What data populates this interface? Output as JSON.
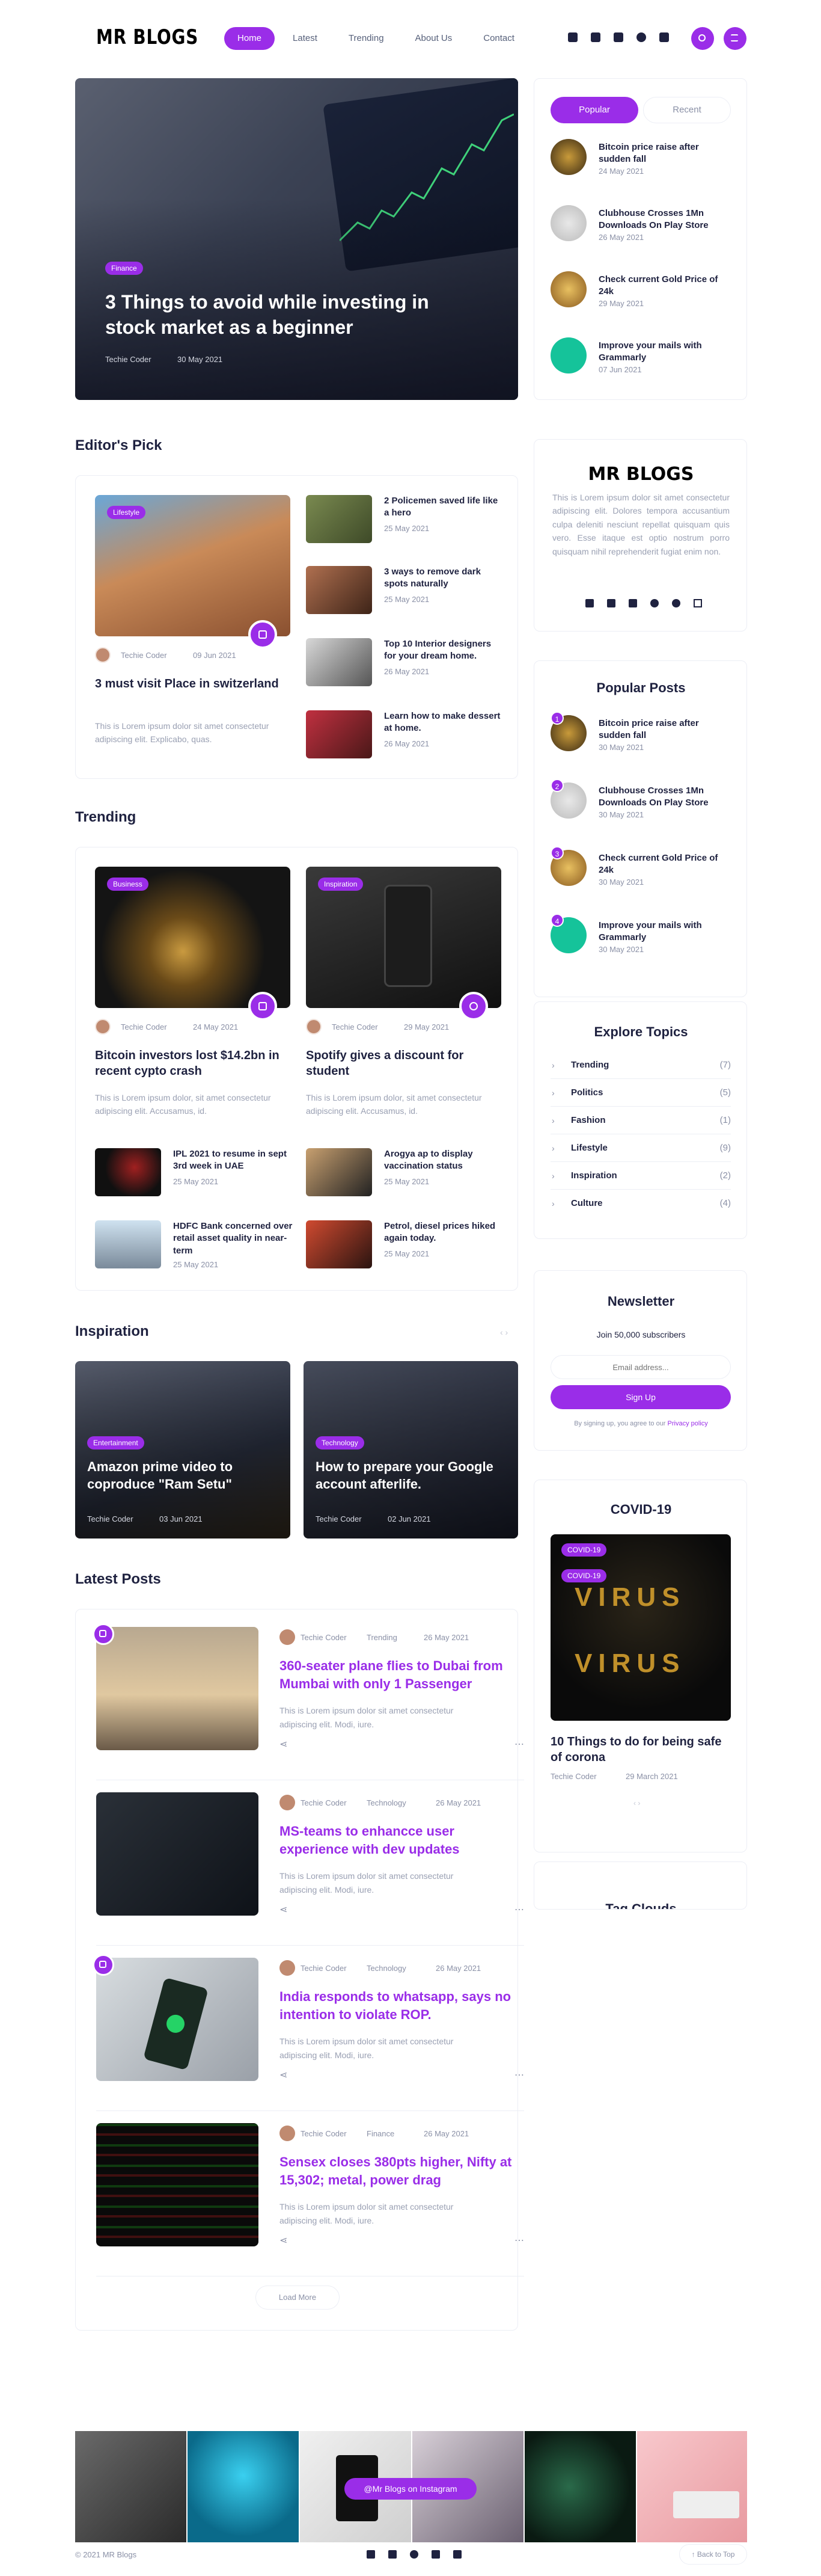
{
  "header": {
    "logo": "MR BLOGS",
    "nav": [
      "Home",
      "Latest",
      "Trending",
      "About Us",
      "Contact"
    ]
  },
  "hero": {
    "tag": "Finance",
    "title": "3 Things to avoid while investing in stock market as a beginner",
    "author": "Techie Coder",
    "date": "30 May 2021"
  },
  "sidebar_tabs": {
    "popular": "Popular",
    "recent": "Recent",
    "items": [
      {
        "title": "Bitcoin price raise after sudden fall",
        "date": "24 May 2021"
      },
      {
        "title": "Clubhouse Crosses 1Mn Downloads On Play Store",
        "date": "26 May 2021"
      },
      {
        "title": "Check current Gold Price of 24k",
        "date": "29 May 2021"
      },
      {
        "title": "Improve your mails with Grammarly",
        "date": "07 Jun 2021"
      }
    ]
  },
  "editors": {
    "heading": "Editor's Pick",
    "main": {
      "tag": "Lifestyle",
      "author": "Techie Coder",
      "date": "09 Jun 2021",
      "title": "3 must visit Place in switzerland",
      "excerpt": "This is Lorem ipsum dolor sit amet consectetur adipiscing elit. Explicabo, quas."
    },
    "list": [
      {
        "title": "2 Policemen saved life like a hero",
        "date": "25 May 2021"
      },
      {
        "title": "3 ways to remove dark spots naturally",
        "date": "25 May 2021"
      },
      {
        "title": "Top 10 Interior designers for your dream home.",
        "date": "26 May 2021"
      },
      {
        "title": "Learn how to make dessert at home.",
        "date": "26 May 2021"
      }
    ]
  },
  "about": {
    "logo": "MR BLOGS",
    "text": "This is Lorem ipsum dolor sit amet consectetur adipiscing elit. Dolores tempora accusantium culpa deleniti nesciunt repellat quisquam quis vero. Esse itaque est optio nostrum porro quisquam nihil reprehenderit fugiat enim non."
  },
  "popular_posts": {
    "heading": "Popular Posts",
    "items": [
      {
        "num": "1",
        "title": "Bitcoin price raise after sudden fall",
        "date": "30 May 2021"
      },
      {
        "num": "2",
        "title": "Clubhouse Crosses 1Mn Downloads On Play Store",
        "date": "30 May 2021"
      },
      {
        "num": "3",
        "title": "Check current Gold Price of 24k",
        "date": "30 May 2021"
      },
      {
        "num": "4",
        "title": "Improve your mails with Grammarly",
        "date": "30 May 2021"
      }
    ]
  },
  "trending": {
    "heading": "Trending",
    "cards": [
      {
        "tag": "Business",
        "author": "Techie Coder",
        "date": "24 May 2021",
        "title": "Bitcoin investors lost $14.2bn in recent cypto crash",
        "excerpt": "This is Lorem ipsum dolor, sit amet consectetur adipiscing elit. Accusamus, id."
      },
      {
        "tag": "Inspiration",
        "author": "Techie Coder",
        "date": "29 May 2021",
        "title": "Spotify gives a discount for student",
        "excerpt": "This is Lorem ipsum dolor, sit amet consectetur adipiscing elit. Accusamus, id."
      }
    ],
    "list": [
      {
        "title": "IPL 2021 to resume in sept 3rd week in UAE",
        "date": "25 May 2021"
      },
      {
        "title": "Arogya ap to display vaccination status",
        "date": "25 May 2021"
      },
      {
        "title": "HDFC Bank concerned over retail asset quality in near-term",
        "date": "25 May 2021"
      },
      {
        "title": "Petrol, diesel prices hiked again today.",
        "date": "25 May 2021"
      }
    ]
  },
  "topics": {
    "heading": "Explore Topics",
    "items": [
      {
        "name": "Trending",
        "count": "(7)"
      },
      {
        "name": "Politics",
        "count": "(5)"
      },
      {
        "name": "Fashion",
        "count": "(1)"
      },
      {
        "name": "Lifestyle",
        "count": "(9)"
      },
      {
        "name": "Inspiration",
        "count": "(2)"
      },
      {
        "name": "Culture",
        "count": "(4)"
      }
    ]
  },
  "inspiration": {
    "heading": "Inspiration",
    "cards": [
      {
        "tag": "Entertainment",
        "title": "Amazon prime video to coproduce \"Ram Setu\"",
        "author": "Techie Coder",
        "date": "03 Jun 2021"
      },
      {
        "tag": "Technology",
        "title": "How to prepare your Google account afterlife.",
        "author": "Techie Coder",
        "date": "02 Jun 2021"
      }
    ]
  },
  "newsletter": {
    "heading": "Newsletter",
    "sub": "Join 50,000 subscribers",
    "placeholder": "Email address...",
    "button": "Sign Up",
    "note": "By signing up, you agree to our ",
    "policy": "Privacy policy"
  },
  "covid": {
    "heading": "COVID-19",
    "tag": "COVID-19",
    "title": "10 Things to do for being safe of corona",
    "author": "Techie Coder",
    "date": "29 March 2021"
  },
  "tagcloud": {
    "heading": "Tag Clouds"
  },
  "latest": {
    "heading": "Latest Posts",
    "items": [
      {
        "author": "Techie Coder",
        "cat": "Trending",
        "date": "26 May 2021",
        "title": "360-seater plane flies to Dubai from Mumbai with only 1 Passenger",
        "excerpt": "This is Lorem ipsum dolor sit amet consectetur adipiscing elit. Modi, iure."
      },
      {
        "author": "Techie Coder",
        "cat": "Technology",
        "date": "26 May 2021",
        "title": "MS-teams to enhancce user experience with dev updates",
        "excerpt": "This is Lorem ipsum dolor sit amet consectetur adipiscing elit. Modi, iure."
      },
      {
        "author": "Techie Coder",
        "cat": "Technology",
        "date": "26 May 2021",
        "title": "India responds to whatsapp, says no intention to violate ROP.",
        "excerpt": "This is Lorem ipsum dolor sit amet consectetur adipiscing elit. Modi, iure."
      },
      {
        "author": "Techie Coder",
        "cat": "Finance",
        "date": "26 May 2021",
        "title": "Sensex closes 380pts higher, Nifty at 15,302; metal, power drag",
        "excerpt": "This is Lorem ipsum dolor sit amet consectetur adipiscing elit. Modi, iure."
      }
    ],
    "load_more": "Load More"
  },
  "instagram": {
    "label": "@Mr Blogs on Instagram"
  },
  "footer": {
    "copyright": "© 2021 MR Blogs",
    "back_to_top": "Back to Top"
  },
  "colors": {
    "accent": "#9a2de8",
    "text": "#1f2240"
  }
}
